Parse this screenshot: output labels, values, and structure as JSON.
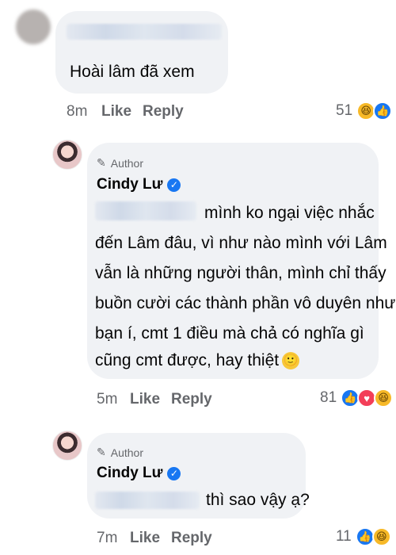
{
  "comment1": {
    "text": "Hoài lâm đã xem",
    "time": "8m",
    "like_label": "Like",
    "reply_label": "Reply",
    "reaction_count": "51",
    "reaction_icons": [
      "haha-icon",
      "like-icon"
    ]
  },
  "reply1": {
    "author_tag": "Author",
    "name": "Cindy Lư",
    "lines": [
      "mình ko ngại việc nhắc",
      "đến Lâm đâu, vì như nào mình với Lâm",
      "vẫn là những người thân, mình chỉ thấy",
      "buồn cười các thành phần vô duyên như",
      "bạn í, cmt 1 điều mà chả có nghĩa gì",
      "cũng cmt được, hay thiệt"
    ],
    "emoji": "🙂",
    "time": "5m",
    "like_label": "Like",
    "reply_label": "Reply",
    "reaction_count": "81",
    "reaction_icons": [
      "like-icon",
      "love-icon",
      "haha-icon"
    ]
  },
  "reply2": {
    "author_tag": "Author",
    "name": "Cindy Lư",
    "text": "thì sao vậy ạ?",
    "time": "7m",
    "like_label": "Like",
    "reply_label": "Reply",
    "reaction_count": "11",
    "reaction_icons": [
      "like-icon",
      "haha-icon"
    ]
  },
  "colors": {
    "bubble": "#f0f2f5",
    "meta_text": "#65676b",
    "verified": "#1877f2"
  }
}
